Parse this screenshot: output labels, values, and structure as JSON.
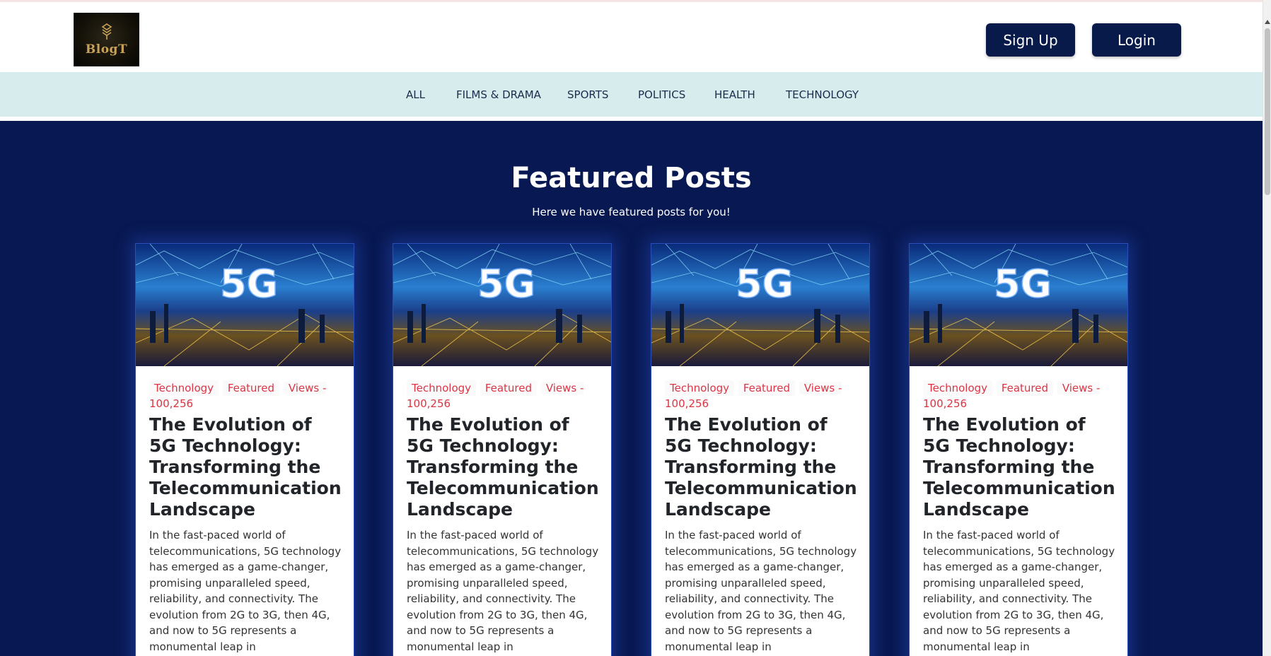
{
  "header": {
    "logo_text": "BlogT",
    "signup_label": "Sign Up",
    "login_label": "Login"
  },
  "nav": {
    "items": [
      {
        "label": "ALL"
      },
      {
        "label": "FILMS & DRAMA"
      },
      {
        "label": "SPORTS"
      },
      {
        "label": "POLITICS"
      },
      {
        "label": "HEALTH"
      },
      {
        "label": "TECHNOLOGY"
      }
    ]
  },
  "featured": {
    "title": "Featured Posts",
    "subtitle": "Here we have featured posts for you!",
    "posts": [
      {
        "image_text": "5G",
        "category": "Technology",
        "badge": "Featured",
        "views": "Views - 100,256",
        "title": "The Evolution of 5G Technology: Transforming the Telecommunication Landscape",
        "excerpt": "In the fast-paced world of telecommunications, 5G technology has emerged as a game-changer, promising unparalleled speed, reliability, and connectivity. The evolution from 2G to 3G, then 4G, and now to 5G represents a monumental leap in telecommunications"
      },
      {
        "image_text": "5G",
        "category": "Technology",
        "badge": "Featured",
        "views": "Views - 100,256",
        "title": "The Evolution of 5G Technology: Transforming the Telecommunication Landscape",
        "excerpt": "In the fast-paced world of telecommunications, 5G technology has emerged as a game-changer, promising unparalleled speed, reliability, and connectivity. The evolution from 2G to 3G, then 4G, and now to 5G represents a monumental leap in telecommunications"
      },
      {
        "image_text": "5G",
        "category": "Technology",
        "badge": "Featured",
        "views": "Views - 100,256",
        "title": "The Evolution of 5G Technology: Transforming the Telecommunication Landscape",
        "excerpt": "In the fast-paced world of telecommunications, 5G technology has emerged as a game-changer, promising unparalleled speed, reliability, and connectivity. The evolution from 2G to 3G, then 4G, and now to 5G represents a monumental leap in telecommunications"
      },
      {
        "image_text": "5G",
        "category": "Technology",
        "badge": "Featured",
        "views": "Views - 100,256",
        "title": "The Evolution of 5G Technology: Transforming the Telecommunication Landscape",
        "excerpt": "In the fast-paced world of telecommunications, 5G technology has emerged as a game-changer, promising unparalleled speed, reliability, and connectivity. The evolution from 2G to 3G, then 4G, and now to 5G represents a monumental leap in telecommunications"
      }
    ]
  },
  "colors": {
    "navy": "#081852",
    "button": "#071a4a",
    "nav_bg": "#d6eced",
    "tag_red": "#dc3545"
  }
}
